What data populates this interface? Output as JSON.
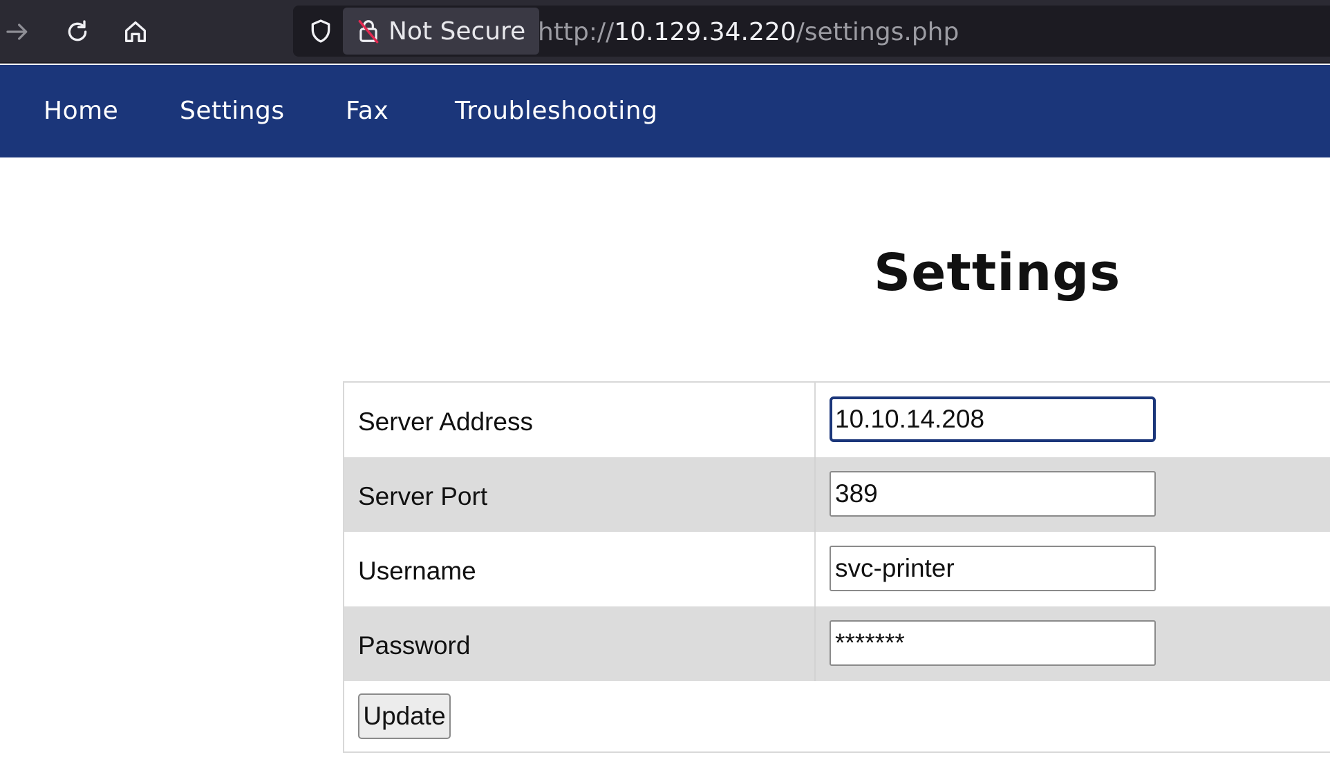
{
  "browser": {
    "security_label": "Not Secure",
    "url_scheme": "http://",
    "url_host": "10.129.34.220",
    "url_path": "/settings.php",
    "icons": [
      "forward-icon",
      "reload-icon",
      "home-icon",
      "shield-icon",
      "insecure-lock-icon"
    ]
  },
  "nav": {
    "items": [
      {
        "label": "Home"
      },
      {
        "label": "Settings"
      },
      {
        "label": "Fax"
      },
      {
        "label": "Troubleshooting"
      }
    ],
    "background": "#1b367a"
  },
  "page": {
    "title": "Settings"
  },
  "form": {
    "rows": [
      {
        "label": "Server Address",
        "value": "10.10.14.208"
      },
      {
        "label": "Server Port",
        "value": "389"
      },
      {
        "label": "Username",
        "value": "svc-printer"
      },
      {
        "label": "Password",
        "value": "*******"
      }
    ],
    "submit_label": "Update"
  }
}
